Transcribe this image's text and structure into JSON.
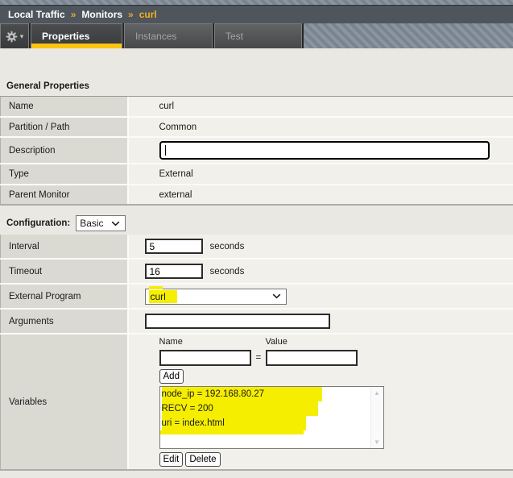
{
  "breadcrumb": {
    "separator": "»",
    "items": [
      {
        "label": "Local Traffic"
      },
      {
        "label": "Monitors"
      },
      {
        "label": "curl"
      }
    ]
  },
  "tabs": {
    "properties": "Properties",
    "instances": "Instances",
    "test": "Test"
  },
  "general": {
    "title": "General Properties",
    "rows": {
      "name": {
        "label": "Name",
        "value": "curl"
      },
      "partition": {
        "label": "Partition / Path",
        "value": "Common"
      },
      "description": {
        "label": "Description",
        "value": ""
      },
      "type": {
        "label": "Type",
        "value": "External"
      },
      "parent": {
        "label": "Parent Monitor",
        "value": "external"
      }
    }
  },
  "configuration": {
    "label": "Configuration:",
    "mode": "Basic",
    "rows": {
      "interval": {
        "label": "Interval",
        "value": "5",
        "unit": "seconds"
      },
      "timeout": {
        "label": "Timeout",
        "value": "16",
        "unit": "seconds"
      },
      "external_program": {
        "label": "External Program",
        "value": "curl"
      },
      "arguments": {
        "label": "Arguments",
        "value": ""
      },
      "variables": {
        "label": "Variables"
      }
    }
  },
  "variables": {
    "name_header": "Name",
    "value_header": "Value",
    "equals": "=",
    "name_input": "",
    "value_input": "",
    "add": "Add",
    "edit": "Edit",
    "delete": "Delete",
    "entries": [
      {
        "text": "node_ip = 192.168.80.27"
      },
      {
        "text": "RECV = 200"
      },
      {
        "text": "uri = index.html"
      }
    ]
  },
  "icons": {
    "gear_caret": "▾",
    "scroll_up": "▲",
    "scroll_down": "▼"
  },
  "colors": {
    "tab_active_underline": "#fdc40f",
    "breadcrumb_gold": "#f2b01e",
    "breadcrumb_separator": "#e8a33d",
    "marker_highlight": "#f5ee00",
    "label_cell_bg": "#dbdad2",
    "value_cell_bg": "#f1f0ea",
    "header_bar_bg": "#4e555d"
  }
}
